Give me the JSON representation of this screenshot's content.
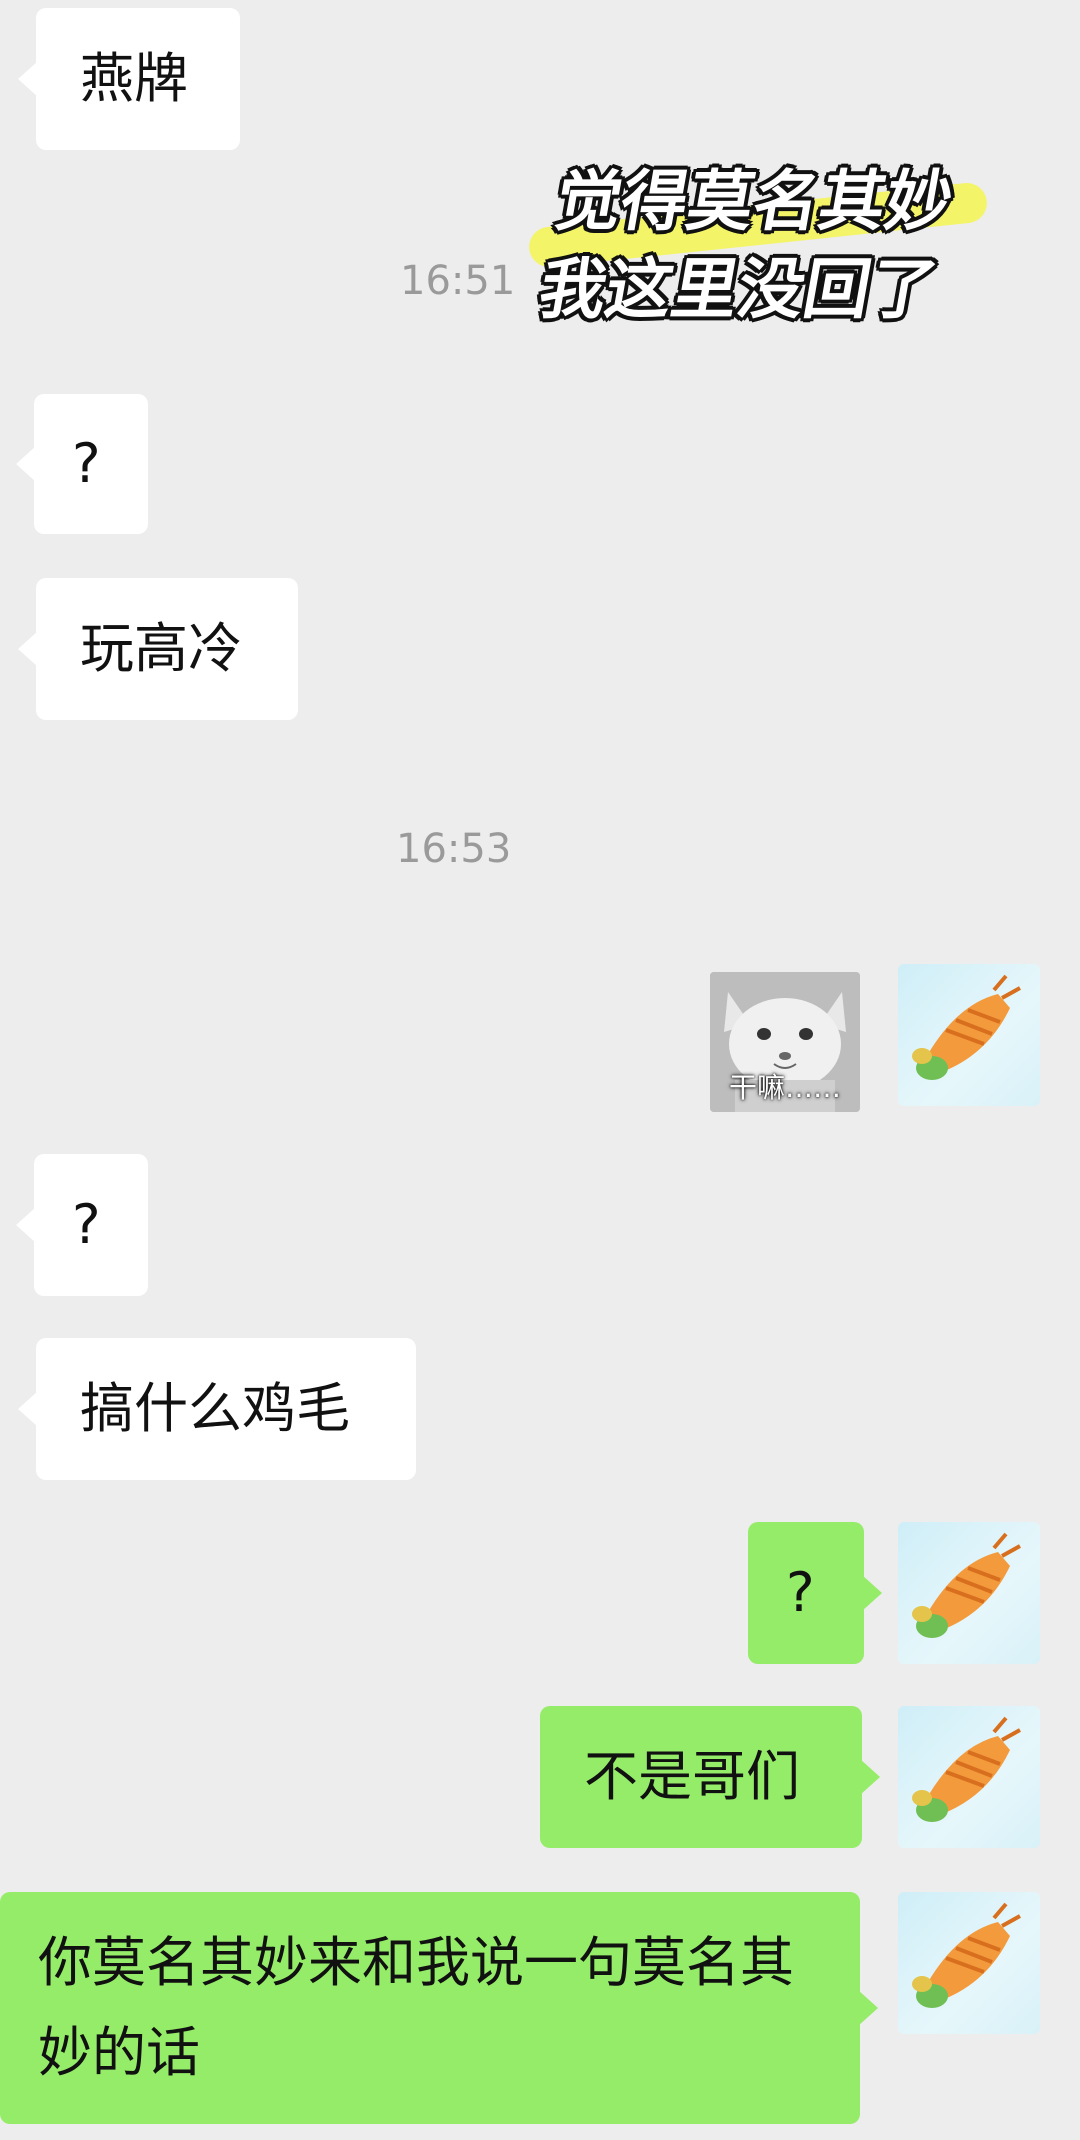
{
  "overlay_caption": {
    "line1": "觉得莫名其妙",
    "line2": "我这里没回了"
  },
  "timestamps": [
    "16:51",
    "16:53"
  ],
  "messages": [
    {
      "side": "left",
      "text": "燕牌"
    },
    {
      "side": "left",
      "text": "?"
    },
    {
      "side": "left",
      "text": "玩高冷"
    },
    {
      "side": "right",
      "type": "sticker",
      "caption": "干嘛……"
    },
    {
      "side": "left",
      "text": "?"
    },
    {
      "side": "left",
      "text": "搞什么鸡毛"
    },
    {
      "side": "right",
      "text": "?"
    },
    {
      "side": "right",
      "text": "不是哥们"
    },
    {
      "side": "right",
      "text": "你莫名其妙来和我说一句莫名其妙的话"
    }
  ],
  "colors": {
    "background": "#ededed",
    "left_bubble": "#ffffff",
    "right_bubble": "#95ec69",
    "timestamp": "#9a9a9a"
  },
  "icons": {
    "self_avatar": "carrot-cartoon-avatar",
    "sticker": "cat-sticker"
  }
}
